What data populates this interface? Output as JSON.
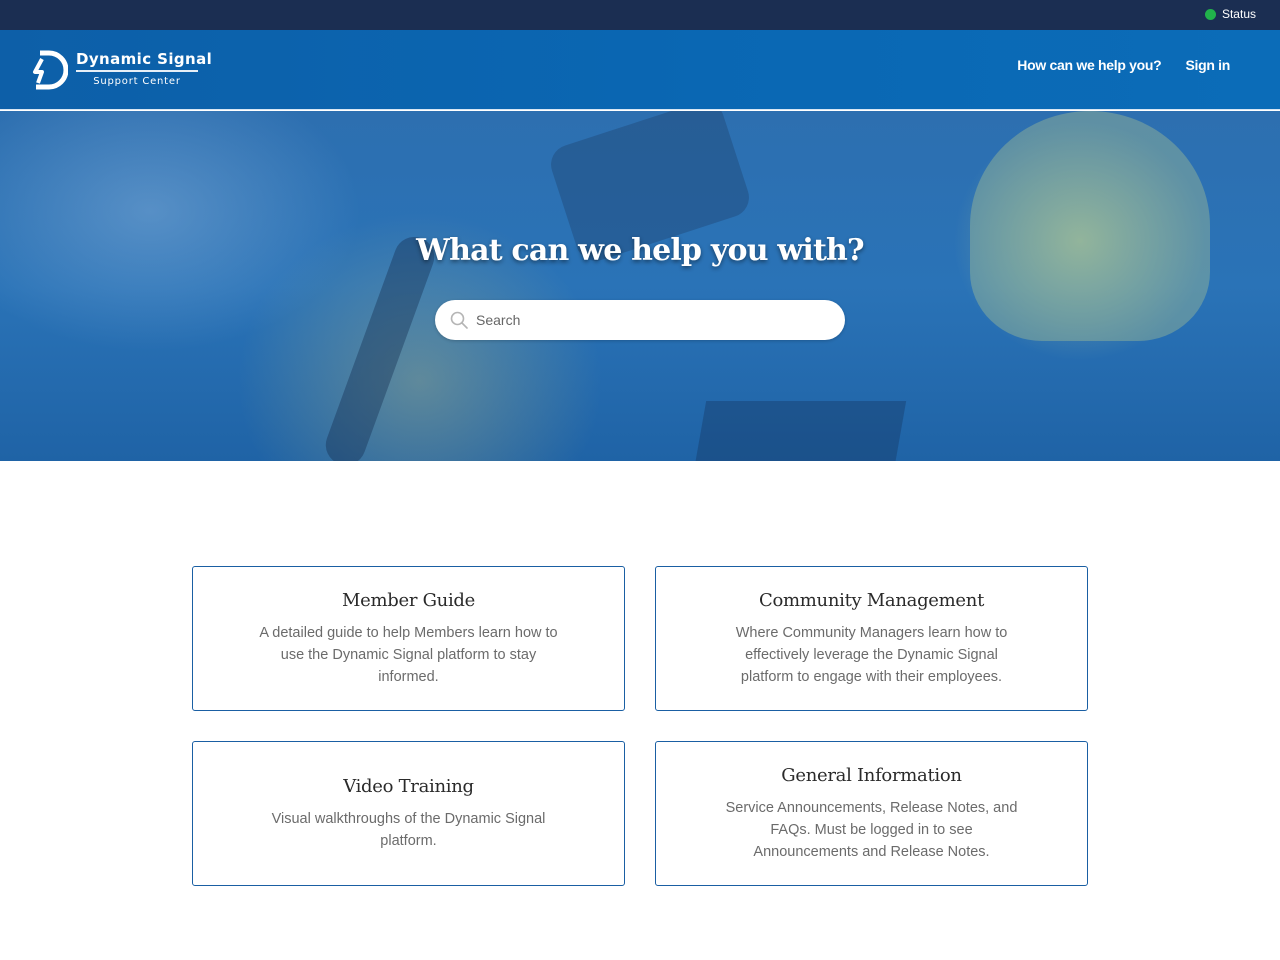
{
  "topbar": {
    "status_label": "Status",
    "status_color": "#21b24b"
  },
  "header": {
    "logo_name": "Dynamic Signal",
    "logo_sub": "Support Center",
    "nav": {
      "help": "How can we help you?",
      "sign_in": "Sign in"
    }
  },
  "hero": {
    "title": "What can we help you with?",
    "search_placeholder": "Search",
    "search_icon": "search-icon"
  },
  "categories": [
    {
      "title": "Member Guide",
      "description": "A detailed guide to help Members learn how to use the Dynamic Signal platform to stay informed."
    },
    {
      "title": "Community Management",
      "description": "Where Community Managers learn how to effectively leverage the Dynamic Signal platform to engage with their employees."
    },
    {
      "title": "Video Training",
      "description": "Visual walkthroughs of the Dynamic Signal platform."
    },
    {
      "title": "General Information",
      "description": "Service Announcements, Release Notes, and FAQs. Must be logged in to see Announcements and Release Notes."
    }
  ],
  "colors": {
    "topbar": "#1b2e52",
    "header": "#0a67b3",
    "card_border": "#1a5fa3"
  }
}
